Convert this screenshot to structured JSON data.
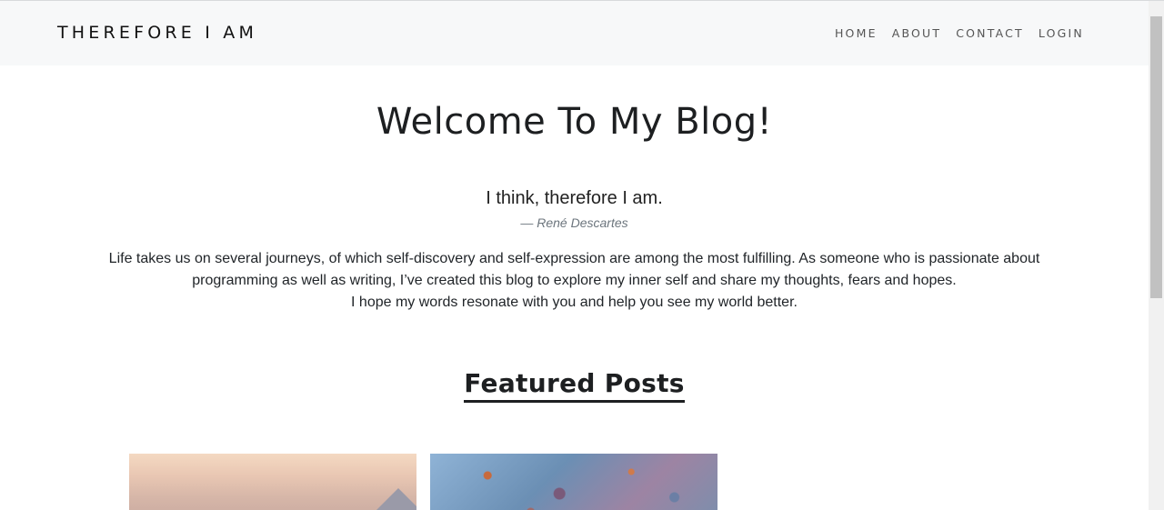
{
  "navbar": {
    "brand": "THEREFORE I AM",
    "links": [
      "HOME",
      "ABOUT",
      "CONTACT",
      "LOGIN"
    ]
  },
  "hero": {
    "title": "Welcome To My Blog!",
    "quote": "I think, therefore I am.",
    "quote_author": "—  René Descartes",
    "intro_lines": [
      "Life takes us on several journeys, of which self-discovery and self-expression are among the most fulfilling. As someone who is passionate about programming as well as writing, I’ve created this blog to explore my inner self and share my thoughts, fears and hopes.",
      "I hope my words resonate with you and help you see my world better."
    ]
  },
  "featured": {
    "title": "Featured Posts"
  }
}
